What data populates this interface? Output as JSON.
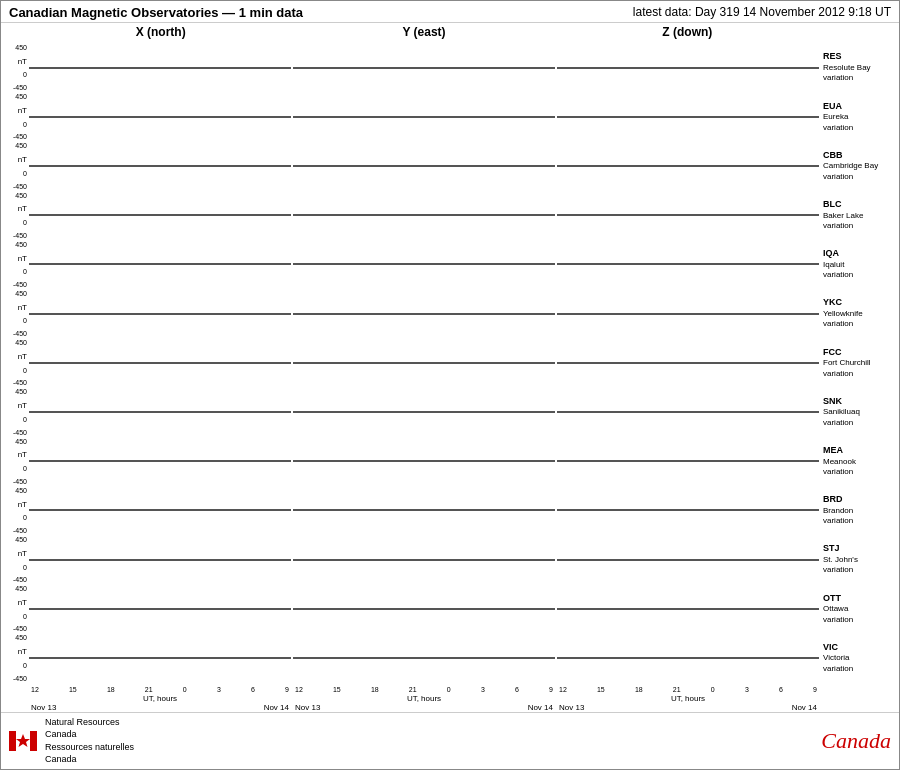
{
  "header": {
    "title": "Canadian Magnetic Observatories — 1 min data",
    "latest_data": "latest data: Day 319   14 November 2012   9:18 UT"
  },
  "columns": {
    "x_label": "X (north)",
    "y_label": "Y (east)",
    "z_label": "Z (down)"
  },
  "y_axis": {
    "top": "450",
    "mid": "0",
    "bot": "-450",
    "unit": "nT"
  },
  "x_axis": {
    "ticks": [
      "12",
      "15",
      "18",
      "21",
      "0",
      "3",
      "6",
      "9"
    ],
    "label": "UT, hours",
    "date_left": "Nov 13",
    "date_right": "Nov 14"
  },
  "stations": [
    {
      "code": "RES",
      "name": "Resolute Bay",
      "type": "variation"
    },
    {
      "code": "EUA",
      "name": "Eureka",
      "type": "variation"
    },
    {
      "code": "CBB",
      "name": "Cambridge Bay",
      "type": "variation"
    },
    {
      "code": "BLC",
      "name": "Baker Lake",
      "type": "variation"
    },
    {
      "code": "IQA",
      "name": "Iqaluit",
      "type": "variation"
    },
    {
      "code": "YKC",
      "name": "Yellowknife",
      "type": "variation"
    },
    {
      "code": "FCC",
      "name": "Fort Churchill",
      "type": "variation"
    },
    {
      "code": "SNK",
      "name": "Sanikiluaq",
      "type": "variation"
    },
    {
      "code": "MEA",
      "name": "Meanook",
      "type": "variation"
    },
    {
      "code": "BRD",
      "name": "Brandon",
      "type": "variation"
    },
    {
      "code": "STJ",
      "name": "St. John's",
      "type": "variation"
    },
    {
      "code": "OTT",
      "name": "Ottawa",
      "type": "variation"
    },
    {
      "code": "VIC",
      "name": "Victoria",
      "type": "variation"
    }
  ],
  "footer": {
    "org_en": "Natural Resources",
    "org_en2": "Canada",
    "org_fr": "Ressources naturelles",
    "org_fr2": "Canada",
    "canada_wordmark": "Canada"
  }
}
